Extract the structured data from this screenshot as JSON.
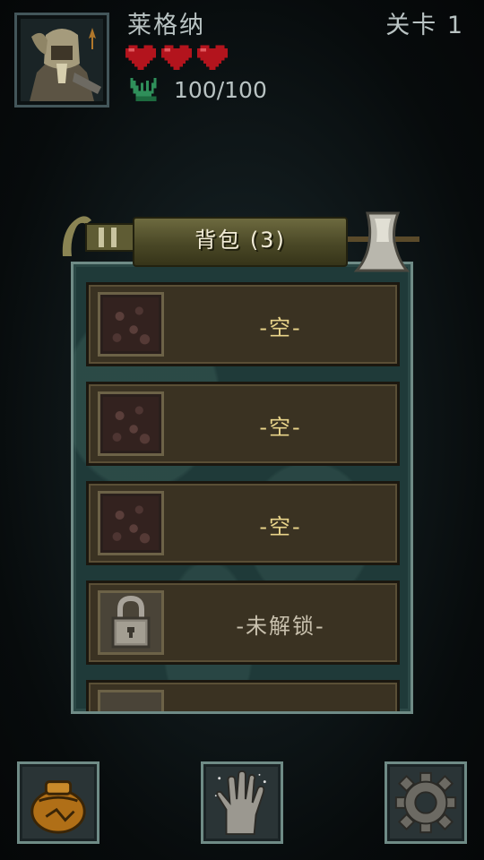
{
  "hud": {
    "player_name": "莱格纳",
    "level_label": "关卡 1",
    "hearts_count": 3,
    "hp_text": "100/100"
  },
  "backpack": {
    "title": "背包 (3)",
    "slots": [
      {
        "label": "-空-",
        "state": "empty",
        "icon": "leather-icon"
      },
      {
        "label": "-空-",
        "state": "empty",
        "icon": "leather-icon"
      },
      {
        "label": "-空-",
        "state": "empty",
        "icon": "leather-icon"
      },
      {
        "label": "-未解锁-",
        "state": "locked",
        "icon": "padlock-icon"
      }
    ]
  },
  "toolbar": {
    "buttons": [
      {
        "name": "bag-button",
        "icon": "sack-icon"
      },
      {
        "name": "hand-button",
        "icon": "hand-icon"
      },
      {
        "name": "settings-button",
        "icon": "gear-icon"
      }
    ]
  },
  "colors": {
    "text_light": "#b9c3c3",
    "slot_text": "#e9d48a",
    "heart": "#b3141d",
    "panel_border": "#6f8b86"
  }
}
